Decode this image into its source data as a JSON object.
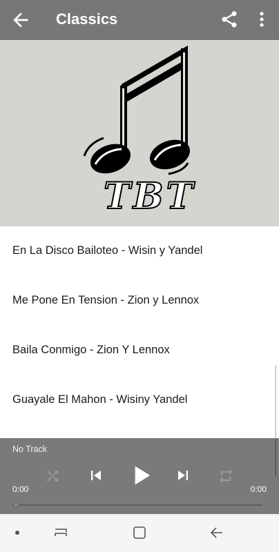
{
  "appbar": {
    "title": "Classics",
    "icons": {
      "back": "arrow-back-icon",
      "share": "share-icon",
      "more": "more-vert-icon"
    }
  },
  "banner": {
    "logo_text": "TBT",
    "logo_icon": "music-note-icon"
  },
  "tracks": [
    "En La Disco Bailoteo - Wisin y Yandel",
    "Me Pone En Tension - Zion y Lennox",
    "Baila Conmigo - Zion Y Lennox",
    "Guayale El Mahon - Wisiny Yandel"
  ],
  "player": {
    "now_playing": "No Track",
    "elapsed": "0:00",
    "duration": "0:00",
    "progress": 0,
    "icons": [
      "shuffle-icon",
      "skip-previous-icon",
      "play-icon",
      "skip-next-icon",
      "repeat-icon"
    ]
  },
  "system_nav": {
    "icons": [
      "dot-icon",
      "recents-icon",
      "home-icon",
      "back-icon"
    ]
  },
  "colors": {
    "appbar": "#777777",
    "player": "#7a7a7a",
    "banner": "#d5d5d0",
    "navbar": "#f5f5f5"
  }
}
